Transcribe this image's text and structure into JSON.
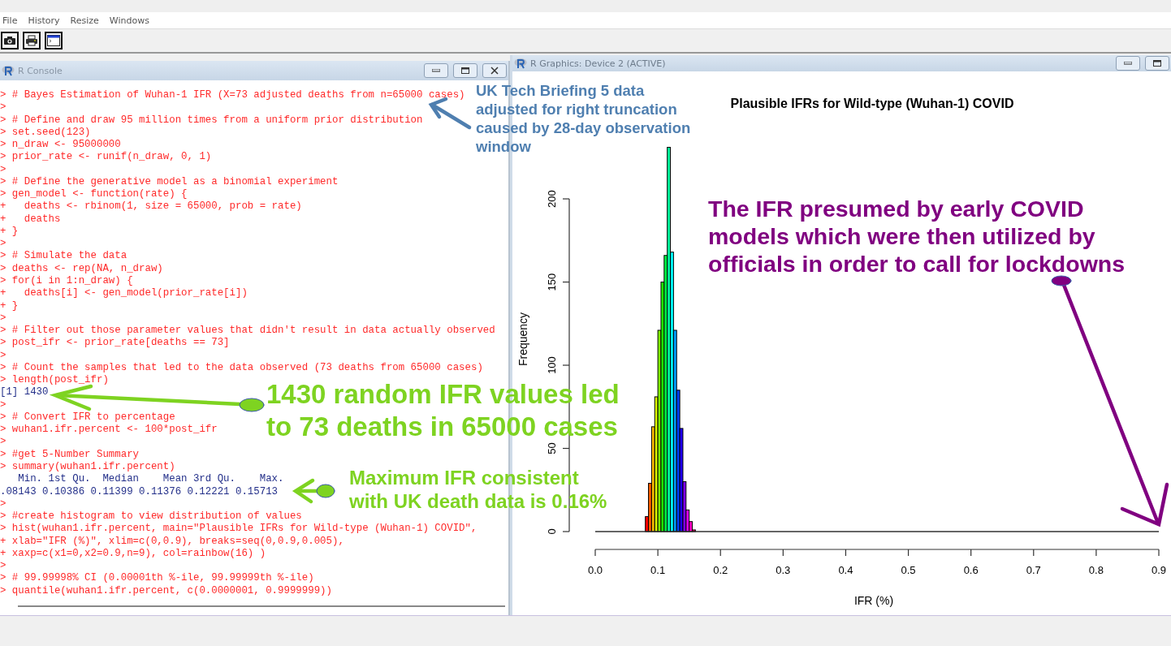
{
  "menu": [
    "File",
    "History",
    "Resize",
    "Windows"
  ],
  "console": {
    "title": "R Console",
    "lines": [
      {
        "kind": "input",
        "prompt": ">",
        "text": "# Bayes Estimation of Wuhan-1 IFR (X=73 adjusted deaths from n=65000 cases)"
      },
      {
        "kind": "input",
        "prompt": ">"
      },
      {
        "kind": "input",
        "prompt": ">",
        "text": "# Define and draw 95 million times from a uniform prior distribution"
      },
      {
        "kind": "input",
        "prompt": ">",
        "text": "set.seed(123)"
      },
      {
        "kind": "input",
        "prompt": ">",
        "text": "n_draw <- 95000000"
      },
      {
        "kind": "input",
        "prompt": ">",
        "text": "prior_rate <- runif(n_draw, 0, 1)"
      },
      {
        "kind": "input",
        "prompt": ">"
      },
      {
        "kind": "input",
        "prompt": ">",
        "text": "# Define the generative model as a binomial experiment"
      },
      {
        "kind": "input",
        "prompt": ">",
        "text": "gen_model <- function(rate) {"
      },
      {
        "kind": "input",
        "prompt": "+",
        "text": "  deaths <- rbinom(1, size = 65000, prob = rate)"
      },
      {
        "kind": "input",
        "prompt": "+",
        "text": "  deaths"
      },
      {
        "kind": "input",
        "prompt": "+",
        "text": "}"
      },
      {
        "kind": "input",
        "prompt": ">"
      },
      {
        "kind": "input",
        "prompt": ">",
        "text": "# Simulate the data"
      },
      {
        "kind": "input",
        "prompt": ">",
        "text": "deaths <- rep(NA, n_draw)"
      },
      {
        "kind": "input",
        "prompt": ">",
        "text": "for(i in 1:n_draw) {"
      },
      {
        "kind": "input",
        "prompt": "+",
        "text": "  deaths[i] <- gen_model(prior_rate[i])"
      },
      {
        "kind": "input",
        "prompt": "+",
        "text": "}"
      },
      {
        "kind": "input",
        "prompt": ">"
      },
      {
        "kind": "input",
        "prompt": ">",
        "text": "# Filter out those parameter values that didn't result in data actually observed"
      },
      {
        "kind": "input",
        "prompt": ">",
        "text": "post_ifr <- prior_rate[deaths == 73]"
      },
      {
        "kind": "input",
        "prompt": ">"
      },
      {
        "kind": "input",
        "prompt": ">",
        "text": "# Count the samples that led to the data observed (73 deaths from 65000 cases)"
      },
      {
        "kind": "input",
        "prompt": ">",
        "text": "length(post_ifr)"
      },
      {
        "kind": "output",
        "text": "[1] 1430"
      },
      {
        "kind": "input",
        "prompt": ">"
      },
      {
        "kind": "input",
        "prompt": ">",
        "text": "# Convert IFR to percentage"
      },
      {
        "kind": "input",
        "prompt": ">",
        "text": "wuhan1.ifr.percent <- 100*post_ifr"
      },
      {
        "kind": "input",
        "prompt": ">"
      },
      {
        "kind": "input",
        "prompt": ">",
        "text": "#get 5-Number Summary"
      },
      {
        "kind": "input",
        "prompt": ">",
        "text": "summary(wuhan1.ifr.percent)"
      },
      {
        "kind": "output",
        "text": "   Min. 1st Qu.  Median    Mean 3rd Qu.    Max."
      },
      {
        "kind": "output",
        "text": ".08143 0.10386 0.11399 0.11376 0.12221 0.15713"
      },
      {
        "kind": "input",
        "prompt": ">"
      },
      {
        "kind": "input",
        "prompt": ">",
        "text": "#create histogram to view distribution of values"
      },
      {
        "kind": "input",
        "prompt": ">",
        "text": "hist(wuhan1.ifr.percent, main=\"Plausible IFRs for Wild-type (Wuhan-1) COVID\","
      },
      {
        "kind": "input",
        "prompt": "+",
        "text": "xlab=\"IFR (%)\", xlim=c(0,0.9), breaks=seq(0,0.9,0.005),"
      },
      {
        "kind": "input",
        "prompt": "+",
        "text": "xaxp=c(x1=0,x2=0.9,n=9), col=rainbow(16) )"
      },
      {
        "kind": "input",
        "prompt": ">"
      },
      {
        "kind": "input",
        "prompt": ">",
        "text": "# 99.99998% CI (0.00001th %-ile, 99.99999th %-ile)"
      },
      {
        "kind": "input",
        "prompt": ">",
        "text": "quantile(wuhan1.ifr.percent, c(0.0000001, 0.9999999))"
      }
    ]
  },
  "graphics": {
    "title": "R Graphics: Device 2 (ACTIVE)",
    "chart_data": {
      "type": "bar",
      "title": "Plausible IFRs for Wild-type (Wuhan-1) COVID",
      "xlabel": "IFR (%)",
      "ylabel": "Frequency",
      "x": [
        0.08,
        0.085,
        0.09,
        0.095,
        0.1,
        0.105,
        0.11,
        0.115,
        0.12,
        0.125,
        0.13,
        0.135,
        0.14,
        0.145,
        0.15,
        0.155
      ],
      "series": [
        {
          "values": [
            9,
            29,
            63,
            81,
            121,
            150,
            166,
            231,
            168,
            121,
            85,
            62,
            30,
            13,
            6,
            1
          ]
        }
      ],
      "colors": [
        "#ff0000",
        "#ff6000",
        "#ffbf00",
        "#dfff00",
        "#80ff00",
        "#20ff00",
        "#00ff40",
        "#00ff9f",
        "#00ffff",
        "#009fff",
        "#0040ff",
        "#2000ff",
        "#8000ff",
        "#df00ff",
        "#ff00bf",
        "#ff0060"
      ],
      "xlim": [
        0,
        0.9
      ],
      "ylim": [
        0,
        231
      ],
      "xticks": [
        {
          "value": 0,
          "label": "0.0"
        },
        {
          "value": 0.1,
          "label": "0.1"
        },
        {
          "value": 0.2,
          "label": "0.2"
        },
        {
          "value": 0.3,
          "label": "0.3"
        },
        {
          "value": 0.4,
          "label": "0.4"
        },
        {
          "value": 0.5,
          "label": "0.5"
        },
        {
          "value": 0.6,
          "label": "0.6"
        },
        {
          "value": 0.7,
          "label": "0.7"
        },
        {
          "value": 0.8,
          "label": "0.8"
        },
        {
          "value": 0.9,
          "label": "0.9"
        }
      ],
      "yticks": [
        0,
        50,
        100,
        150,
        200
      ]
    }
  },
  "annotations": [
    {
      "lines": [
        "UK Tech Briefing 5 data",
        "adjusted for right truncation",
        "caused by 28-day observation",
        "window"
      ],
      "color": "#4f7fb0"
    },
    {
      "lines": [
        "1430 random IFR values led",
        "to 73 deaths in 65000 cases"
      ],
      "color": "#7ed321"
    },
    {
      "lines": [
        "Maximum IFR consistent",
        "with UK death data is 0.16%"
      ],
      "color": "#7ed321"
    },
    {
      "lines": [
        "The IFR presumed by early COVID",
        "models which were then utilized by",
        "officials in order to call for lockdowns"
      ],
      "color": "#800080"
    }
  ]
}
